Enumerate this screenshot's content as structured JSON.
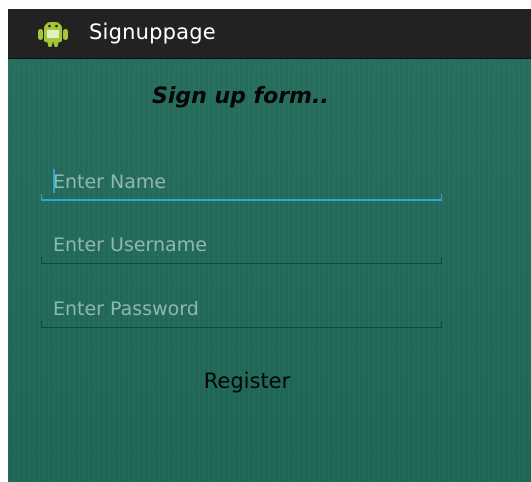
{
  "action_bar": {
    "title": "Signuppage",
    "icon": "android-icon"
  },
  "form": {
    "title": "Sign up form..",
    "fields": [
      {
        "name": "name",
        "value": "",
        "placeholder": "Enter Name",
        "focused": true
      },
      {
        "name": "username",
        "value": "",
        "placeholder": "Enter Username",
        "focused": false
      },
      {
        "name": "password",
        "value": "",
        "placeholder": "Enter Password",
        "focused": false
      }
    ],
    "register_label": "Register"
  },
  "colors": {
    "background": "#206a59",
    "action_bar": "#222222",
    "focus_accent": "#2aa7d8",
    "android_green": "#a4c639"
  }
}
